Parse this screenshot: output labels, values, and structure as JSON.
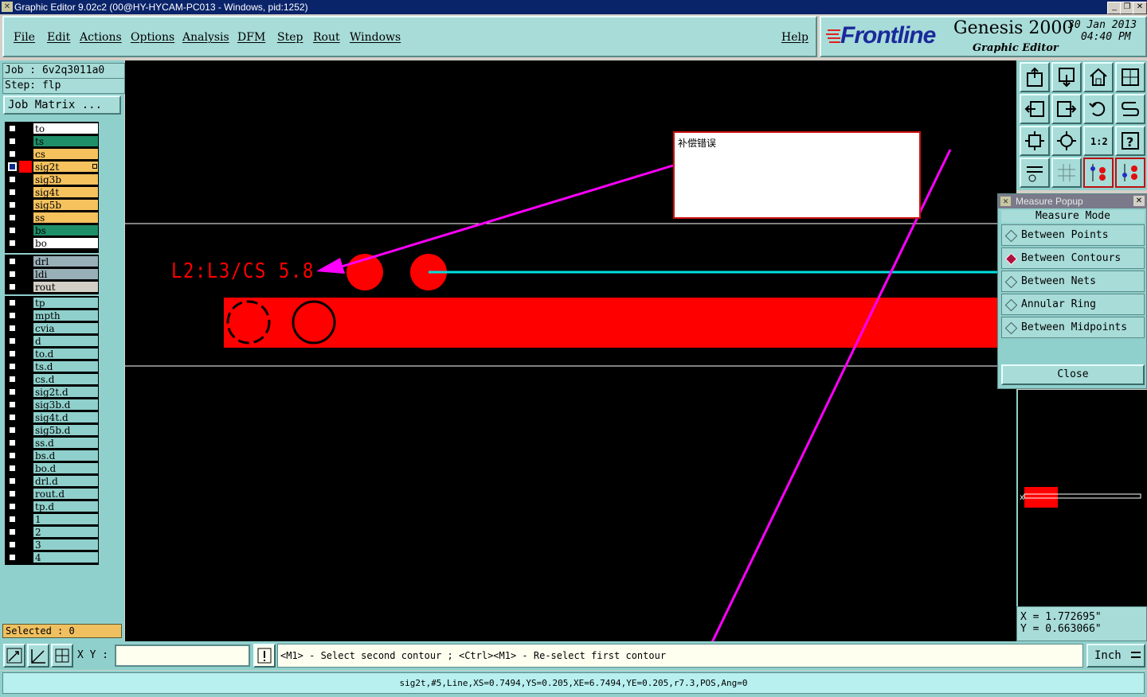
{
  "window": {
    "title": "Graphic Editor 9.02c2 (00@HY-HYCAM-PC013 - Windows, pid:1252)"
  },
  "menu": {
    "items": [
      "File",
      "Edit",
      "Actions",
      "Options",
      "Analysis",
      "DFM",
      "Step",
      "Rout",
      "Windows"
    ],
    "help": "Help"
  },
  "brand": {
    "logo": "Frontline",
    "product": "Genesis 2000",
    "subtitle": "Graphic Editor",
    "date": "30 Jan 2013",
    "time": "04:40 PM"
  },
  "job": {
    "job_label": "Job : 6v2q3011a0",
    "step_label": "Step: flp",
    "matrix_button": "Job Matrix ..."
  },
  "layers": {
    "board": [
      {
        "name": "to",
        "color": "#ffffff",
        "active": false
      },
      {
        "name": "ts",
        "color": "#1f8f6a",
        "active": false
      },
      {
        "name": "cs",
        "color": "#f5c25e",
        "active": false
      },
      {
        "name": "sig2t",
        "color": "#f5c25e",
        "active": true
      },
      {
        "name": "sig3b",
        "color": "#f5c25e",
        "active": false
      },
      {
        "name": "sig4t",
        "color": "#f5c25e",
        "active": false
      },
      {
        "name": "sig5b",
        "color": "#f5c25e",
        "active": false
      },
      {
        "name": "ss",
        "color": "#f5c25e",
        "active": false
      },
      {
        "name": "bs",
        "color": "#1f8f6a",
        "active": false
      },
      {
        "name": "bo",
        "color": "#ffffff",
        "active": false
      }
    ],
    "drill": [
      {
        "name": "drl",
        "color": "#9ab0b8"
      },
      {
        "name": "ldi",
        "color": "#9ab0b8"
      },
      {
        "name": "rout",
        "color": "#d4d0c8"
      }
    ],
    "misc": [
      "tp",
      "mpth",
      "cvia",
      "d",
      "to.d",
      "ts.d",
      "cs.d",
      "sig2t.d",
      "sig3b.d",
      "sig4t.d",
      "sig5b.d",
      "ss.d",
      "bs.d",
      "bo.d",
      "drl.d",
      "rout.d",
      "tp.d",
      "1",
      "2",
      "3",
      "4"
    ]
  },
  "selected_label": "Selected : 0",
  "canvas": {
    "annotation_text": "补偿错误",
    "pcb_label": "L2:L3/CS 5.8",
    "colors": {
      "feature": "#ff0000",
      "measure_line": "#00e0e0",
      "arrow": "#ff00ff",
      "annotation_border": "#d01010"
    }
  },
  "measure_popup": {
    "title": "Measure Popup",
    "mode_label": "Measure Mode",
    "options": [
      {
        "label": "Between Points",
        "selected": false
      },
      {
        "label": "Between Contours",
        "selected": true
      },
      {
        "label": "Between Nets",
        "selected": false
      },
      {
        "label": "Annular Ring",
        "selected": false
      },
      {
        "label": "Between Midpoints",
        "selected": false
      }
    ],
    "close_label": "Close"
  },
  "coords": {
    "x": "X = 1.772695\"",
    "y": "Y = 0.663066\""
  },
  "bottom": {
    "xy_label": "X Y :",
    "xy_value": "",
    "prompt": "<M1> - Select second contour ; <Ctrl><M1> - Re-select first contour",
    "units": "Inch",
    "status": "sig2t,#5,Line,XS=0.7494,YS=0.205,XE=6.7494,YE=0.205,r7.3,POS,Ang=0"
  }
}
